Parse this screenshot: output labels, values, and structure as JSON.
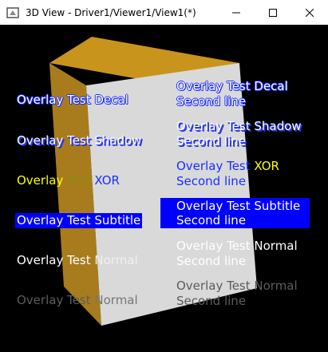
{
  "window": {
    "title": "3D View - Driver1/Viewer1/View1(*)",
    "minimize_icon": "minimize-icon",
    "maximize_icon": "maximize-icon",
    "close_icon": "close-icon"
  },
  "colors": {
    "background": "#000000",
    "box_front": "#d9d9d9",
    "box_side": "#a87c1c",
    "box_top": "#c8941c",
    "subtitle_bg": "#0000ff",
    "xor_yellow": "#ffff00"
  },
  "left_labels": {
    "decal": "Overlay Test Decal",
    "shadow": "Overlay Test Shadow",
    "xor_part1": "Overlay",
    "xor_part2": " Test",
    "xor_part3": " XOR",
    "subtitle": "Overlay Test Subtitle",
    "normal_part1": "Overlay Test",
    "normal_part2": " Normal",
    "normal_gray_part1": "Overlay Test",
    "normal_gray_part2": " Normal"
  },
  "right_labels": {
    "decal_line1": "Overlay Test Decal",
    "decal_line2": "Second line",
    "shadow_line1": "Overlay Test Shadow",
    "shadow_line2": "Second line",
    "xor_line1a": "Overlay Test",
    "xor_line1b": " XOR",
    "xor_line2": "Second line",
    "subtitle_line1": "Overlay Test Subtitle",
    "subtitle_line2": "Second line",
    "normal_line1": "Overlay Test Normal",
    "normal_line2": "Second line",
    "normal_gray_line1": "Overlay Test Normal",
    "normal_gray_line2": "Second line"
  }
}
